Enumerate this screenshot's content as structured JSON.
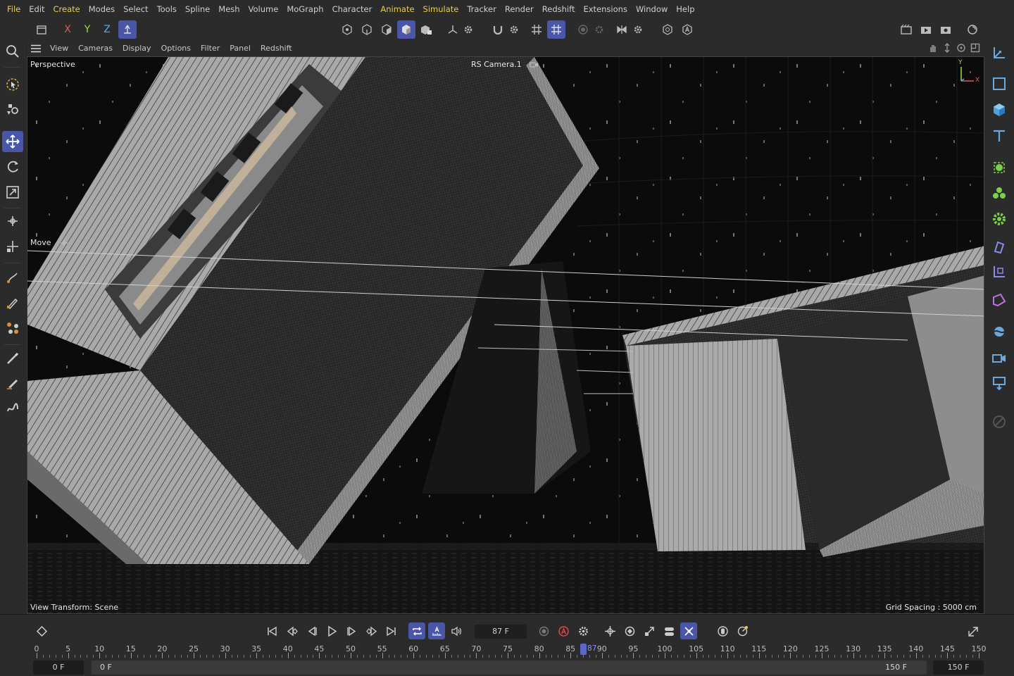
{
  "menu": [
    "File",
    "Edit",
    "Create",
    "Modes",
    "Select",
    "Tools",
    "Spline",
    "Mesh",
    "Volume",
    "MoGraph",
    "Character",
    "Animate",
    "Simulate",
    "Tracker",
    "Render",
    "Redshift",
    "Extensions",
    "Window",
    "Help"
  ],
  "menu_highlight": [
    "File",
    "Create",
    "Animate",
    "Simulate"
  ],
  "toolbar": {
    "axis_x": "X",
    "axis_y": "Y",
    "axis_z": "Z"
  },
  "viewport_menu": [
    "View",
    "Cameras",
    "Display",
    "Options",
    "Filter",
    "Panel",
    "Redshift"
  ],
  "viewport": {
    "view_name": "Perspective",
    "camera_name": "RS Camera.1",
    "tool_name": "Move",
    "view_transform": "View Transform: Scene",
    "grid_spacing": "Grid Spacing : 5000 cm",
    "axis_y": "Y",
    "axis_x": "X"
  },
  "timeline": {
    "current_frame": "87 F",
    "playhead_value": 87,
    "playhead_label": "87",
    "ruler_labels": [
      "0",
      "5",
      "10",
      "15",
      "20",
      "25",
      "30",
      "35",
      "40",
      "45",
      "50",
      "55",
      "60",
      "65",
      "70",
      "75",
      "80",
      "85",
      "90",
      "95",
      "100",
      "105",
      "110",
      "115",
      "120",
      "125",
      "130",
      "135",
      "140",
      "145",
      "150"
    ],
    "start_frame": "0 F",
    "range_start": "0 F",
    "range_end": "150 F",
    "end_frame": "150 F",
    "max_frame": 150
  },
  "colors": {
    "accent": "#4a56a8",
    "highlight_text": "#e8cf4a",
    "panel": "#2b2b2b",
    "viewport_bg": "#0b0b0b"
  }
}
